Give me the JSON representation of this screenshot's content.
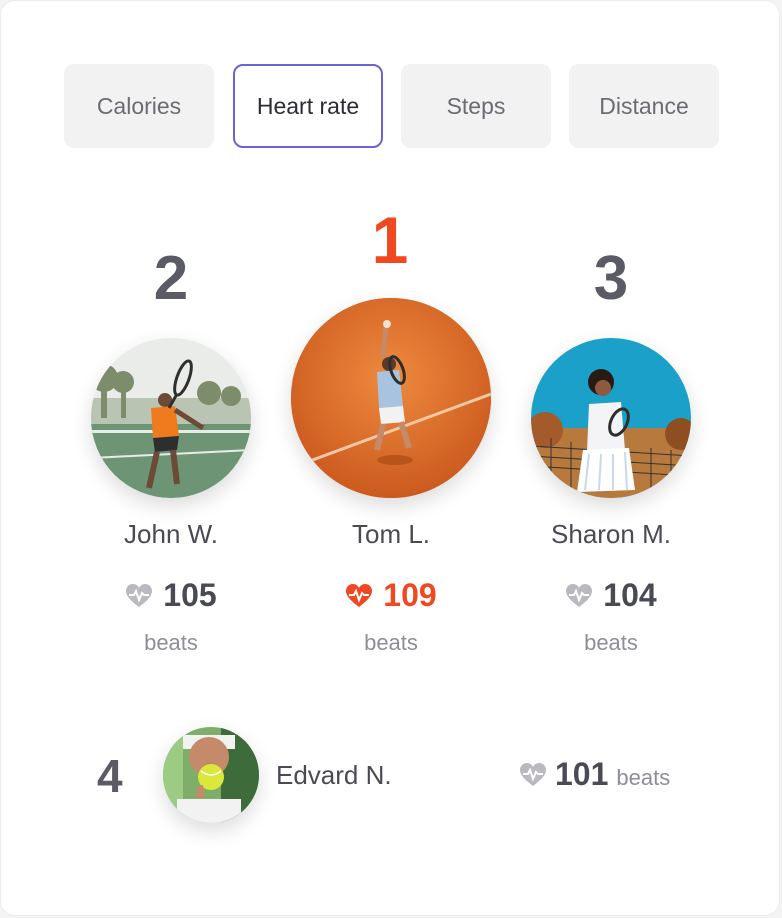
{
  "tabs": [
    {
      "label": "Calories",
      "active": false
    },
    {
      "label": "Heart rate",
      "active": true
    },
    {
      "label": "Steps",
      "active": false
    },
    {
      "label": "Distance",
      "active": false
    }
  ],
  "podium": [
    {
      "rank": "1",
      "name": "Tom L.",
      "value": "109",
      "unit": "beats",
      "icon": "heart-pulse-icon",
      "color": "#f04821"
    },
    {
      "rank": "2",
      "name": "John W.",
      "value": "105",
      "unit": "beats",
      "icon": "heart-pulse-icon",
      "color": "#b9b9bf"
    },
    {
      "rank": "3",
      "name": "Sharon M.",
      "value": "104",
      "unit": "beats",
      "icon": "heart-pulse-icon",
      "color": "#b9b9bf"
    }
  ],
  "list": [
    {
      "rank": "4",
      "name": "Edvard N.",
      "value": "101",
      "unit": "beats",
      "icon": "heart-pulse-icon"
    }
  ],
  "colors": {
    "accent": "#6b63d4",
    "leader": "#f04821",
    "muted_heart": "#b9b9bf"
  }
}
